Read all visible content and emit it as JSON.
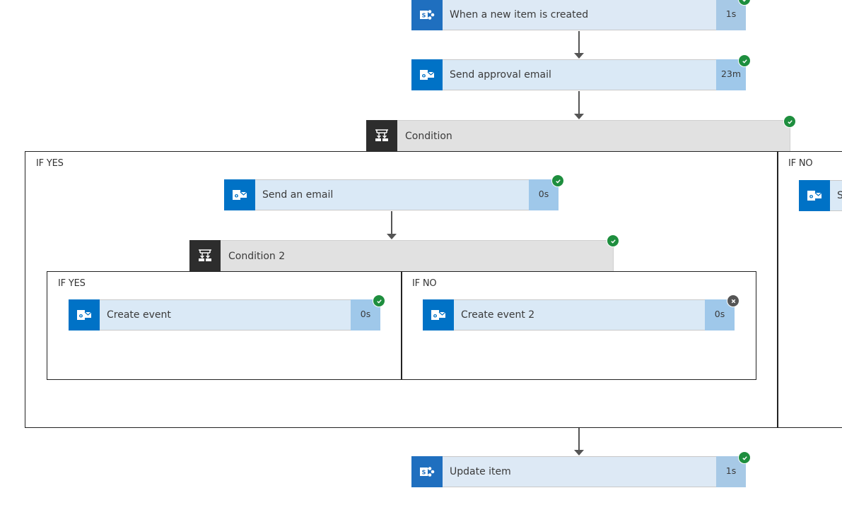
{
  "flow": {
    "trigger": {
      "title": "When a new item is created",
      "duration": "1s",
      "service": "sharepoint-icon",
      "status": "succeeded"
    },
    "approval": {
      "title": "Send approval email",
      "duration": "23m",
      "service": "outlook-icon",
      "status": "succeeded"
    },
    "condition": {
      "title": "Condition",
      "status": "succeeded",
      "if_yes": {
        "label": "IF YES",
        "send_email": {
          "title": "Send an email",
          "duration": "0s",
          "service": "outlook-icon",
          "status": "succeeded"
        },
        "condition2": {
          "title": "Condition 2",
          "status": "succeeded",
          "if_yes": {
            "label": "IF YES",
            "create_event": {
              "title": "Create event",
              "duration": "0s",
              "service": "outlook-icon",
              "status": "succeeded"
            }
          },
          "if_no": {
            "label": "IF NO",
            "create_event2": {
              "title": "Create event 2",
              "duration": "0s",
              "service": "outlook-icon",
              "status": "failed"
            }
          }
        }
      },
      "if_no": {
        "label": "IF NO",
        "partial_card_title": "S"
      }
    },
    "update": {
      "title": "Update item",
      "duration": "1s",
      "service": "sharepoint-icon",
      "status": "succeeded"
    }
  },
  "colors": {
    "outlook_blue": "#0072c6",
    "sharepoint_blue": "#1f6fbf",
    "card_bg": "#dae9f6",
    "duration_bg": "#9fc8ea",
    "success_green": "#1e8e3e",
    "failed_gray": "#555555",
    "condition_bg": "#e1e1e1",
    "condition_icon_bg": "#2d2d2d"
  }
}
